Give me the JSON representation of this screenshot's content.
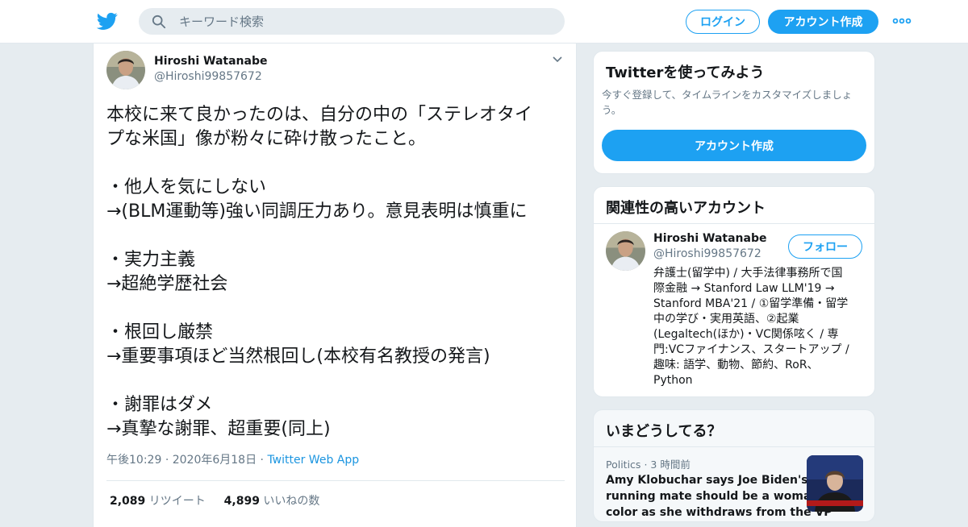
{
  "topbar": {
    "search_placeholder": "キーワード検索",
    "login_label": "ログイン",
    "signup_label": "アカウント作成"
  },
  "tweet": {
    "author_name": "Hiroshi Watanabe",
    "author_handle": "@Hiroshi99857672",
    "lines": [
      "本校に来て良かったのは、自分の中の「ステレオタイ",
      "プな米国」像が粉々に砕け散ったこと。",
      "",
      "・他人を気にしない",
      "→(BLM運動等)強い同調圧力あり。意見表明は慎重に",
      "",
      "・実力主義",
      "→超絶学歴社会",
      "",
      "・根回し厳禁",
      "→重要事項ほど当然根回し(本校有名教授の発言)",
      "",
      "・謝罪はダメ",
      "→真摯な謝罪、超重要(同上)"
    ],
    "time": "午後10:29",
    "date": "2020年6月18日",
    "source": "Twitter Web App",
    "retweet_count": "2,089",
    "retweet_label": "リツイート",
    "like_count": "4,899",
    "like_label": "いいねの数"
  },
  "signup_card": {
    "title": "Twitterを使ってみよう",
    "desc_line1": "今すぐ登録して、タイムラインをカスタマイズしましょ",
    "desc_line2": "う。",
    "button_label": "アカウント作成"
  },
  "related_card": {
    "title": "関連性の高いアカウント",
    "name": "Hiroshi Watanabe",
    "handle": "@Hiroshi99857672",
    "follow_label": "フォロー",
    "bio_lines": [
      "弁護士(留学中) / 大手法律事務所で国",
      "際金融 → Stanford Law LLM'19 →",
      "Stanford MBA'21 / ①留学準備・留学",
      "中の学び・実用英語、②起業",
      "(Legaltech(ほか)・VC関係呟く / 専",
      "門:VCファイナンス、スタートアップ /",
      "趣味: 語学、動物、節約、RoR、",
      "Python"
    ]
  },
  "trends_card": {
    "title": "いまどうしてる？",
    "category": "Politics",
    "time_ago": "3 時間前",
    "headline_lines": [
      "Amy Klobuchar says Joe Biden's",
      "running mate should be a woman of",
      "color as she withdraws from the VP"
    ]
  },
  "colors": {
    "accent": "#1da1f2",
    "link": "#1b95e0",
    "secondary_text": "#657786",
    "background": "#e6ecf0"
  },
  "icons": [
    "twitter-bird-icon",
    "search-icon",
    "more-dots-icon",
    "chevron-down-icon"
  ]
}
